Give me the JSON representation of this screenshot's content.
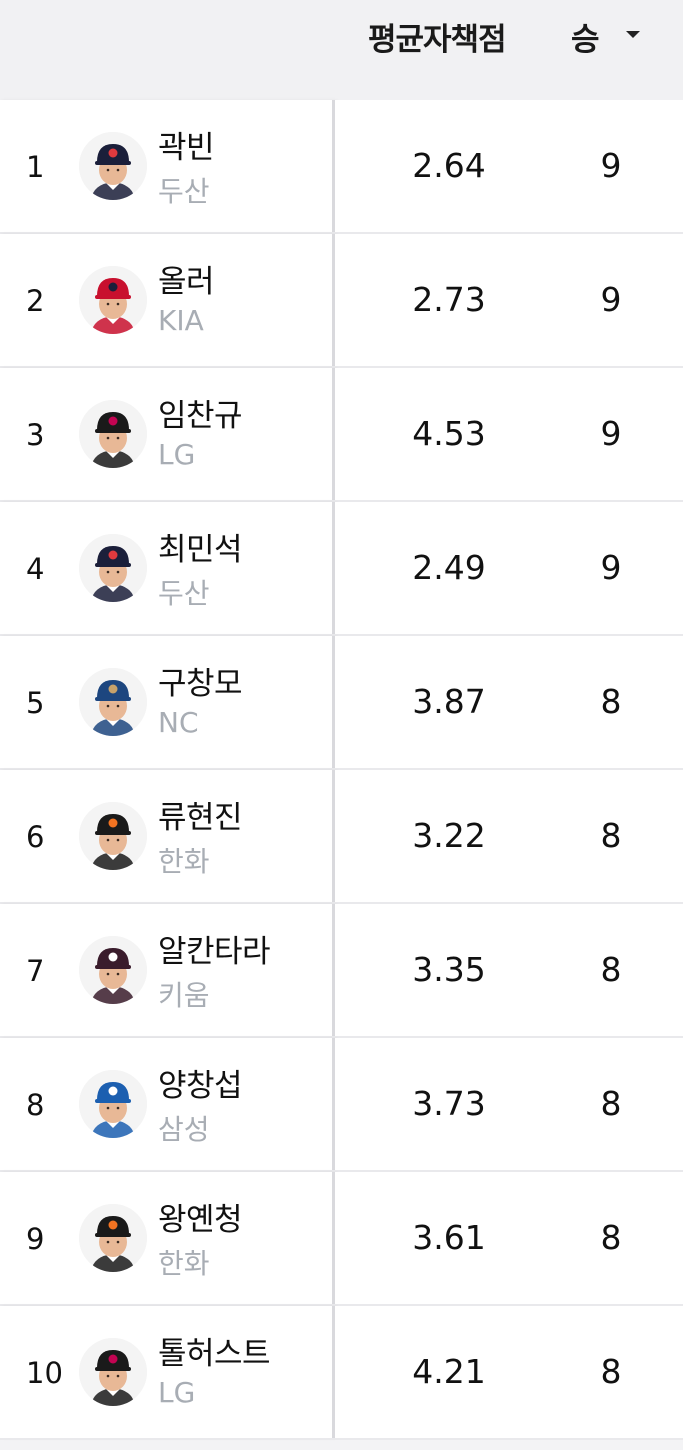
{
  "table": {
    "columns": {
      "era": "평균자책점",
      "wins": "승"
    },
    "sort": {
      "column": "승",
      "direction": "desc",
      "icon": "caret-down-icon"
    },
    "rows": [
      {
        "rank": "1",
        "name": "곽빈",
        "team": "두산",
        "era": "2.64",
        "wins": "9",
        "cap": "#1b1f3a",
        "logo": "#e03a3e"
      },
      {
        "rank": "2",
        "name": "올러",
        "team": "KIA",
        "era": "2.73",
        "wins": "9",
        "cap": "#c8102e",
        "logo": "#1b1f3a"
      },
      {
        "rank": "3",
        "name": "임찬규",
        "team": "LG",
        "era": "4.53",
        "wins": "9",
        "cap": "#1a1a1a",
        "logo": "#c30452"
      },
      {
        "rank": "4",
        "name": "최민석",
        "team": "두산",
        "era": "2.49",
        "wins": "9",
        "cap": "#1b1f3a",
        "logo": "#e03a3e"
      },
      {
        "rank": "5",
        "name": "구창모",
        "team": "NC",
        "era": "3.87",
        "wins": "8",
        "cap": "#1d467f",
        "logo": "#c7a26b"
      },
      {
        "rank": "6",
        "name": "류현진",
        "team": "한화",
        "era": "3.22",
        "wins": "8",
        "cap": "#1a1a1a",
        "logo": "#f37321"
      },
      {
        "rank": "7",
        "name": "알칸타라",
        "team": "키움",
        "era": "3.35",
        "wins": "8",
        "cap": "#3a1c2c",
        "logo": "#ffffff"
      },
      {
        "rank": "8",
        "name": "양창섭",
        "team": "삼성",
        "era": "3.73",
        "wins": "8",
        "cap": "#1c5fb0",
        "logo": "#ffffff"
      },
      {
        "rank": "9",
        "name": "왕옌청",
        "team": "한화",
        "era": "3.61",
        "wins": "8",
        "cap": "#1a1a1a",
        "logo": "#f37321"
      },
      {
        "rank": "10",
        "name": "톨허스트",
        "team": "LG",
        "era": "4.21",
        "wins": "8",
        "cap": "#1a1a1a",
        "logo": "#c30452"
      }
    ]
  }
}
